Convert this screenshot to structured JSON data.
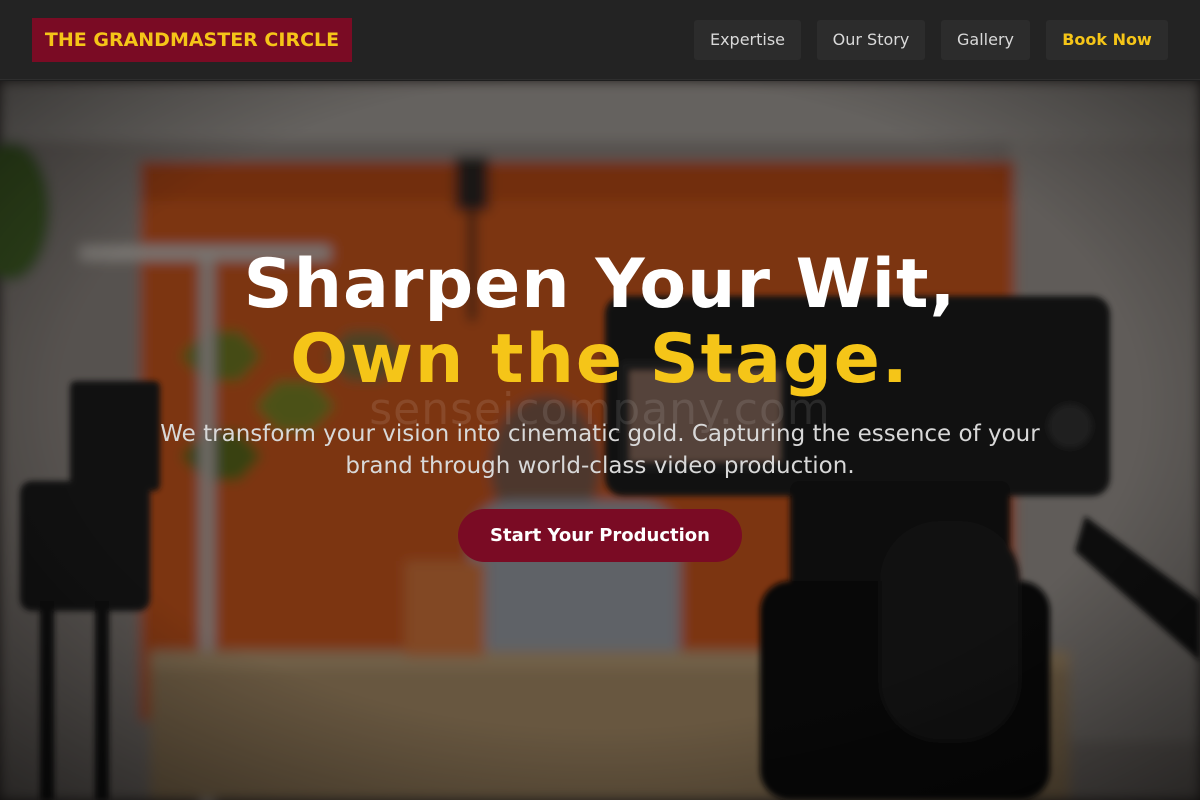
{
  "header": {
    "logo_text": "THE GRANDMASTER CIRCLE",
    "nav": {
      "expertise": "Expertise",
      "our_story": "Our Story",
      "gallery": "Gallery",
      "book_now": "Book Now"
    }
  },
  "hero": {
    "headline_line1": "Sharpen Your Wit,",
    "headline_line2": "Own the Stage.",
    "subtext": "We transform your vision into cinematic gold. Capturing the essence of your brand through world-class video production.",
    "cta_label": "Start Your Production",
    "watermark": "senseicompany.com"
  },
  "colors": {
    "brand_maroon": "#7a0b24",
    "accent_gold": "#f5c518",
    "header_bg": "#232323",
    "nav_button_bg": "#2c2c2c"
  }
}
